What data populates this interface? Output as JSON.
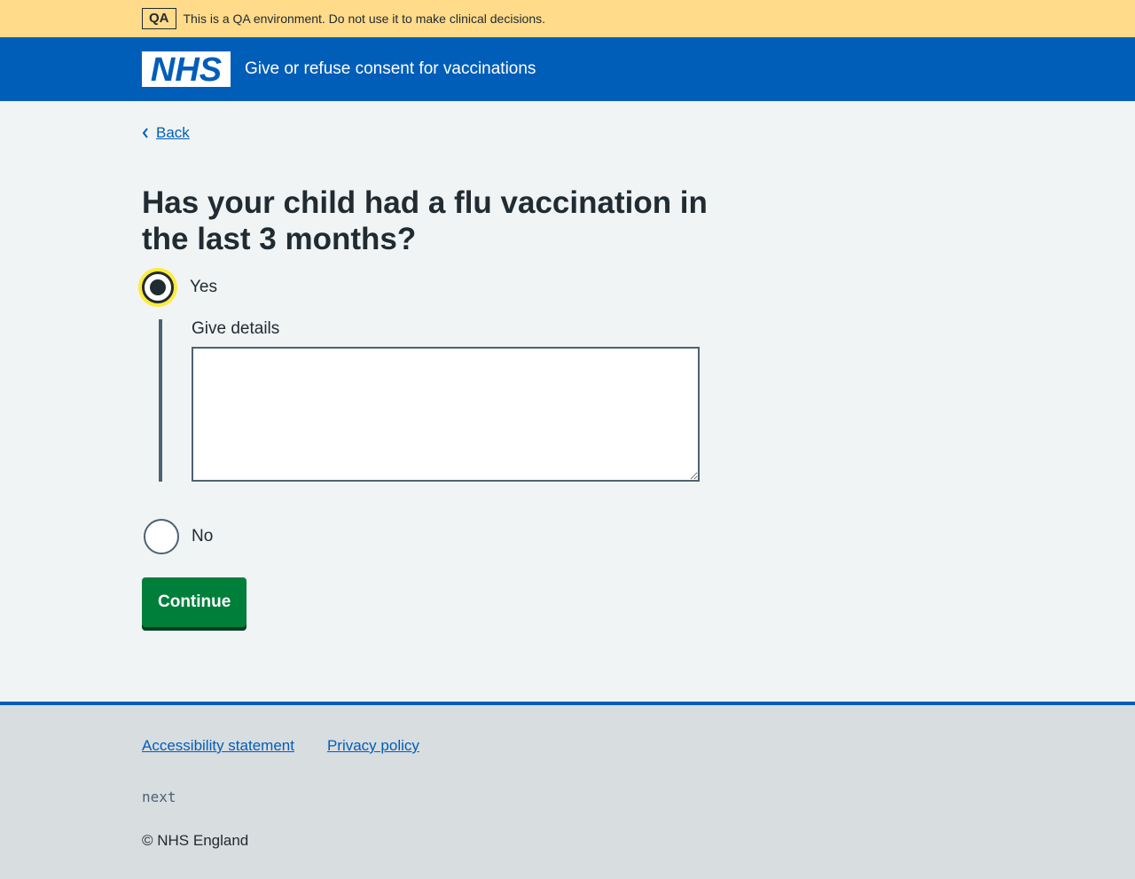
{
  "banner": {
    "tag": "QA",
    "message": "This is a QA environment. Do not use it to make clinical decisions."
  },
  "header": {
    "logo_text": "NHS",
    "title": "Give or refuse consent for vaccinations"
  },
  "main": {
    "back_label": "Back",
    "heading": "Has your child had a flu vaccination in the last 3 months?",
    "options": [
      {
        "label": "Yes",
        "selected": true
      },
      {
        "label": "No",
        "selected": false
      }
    ],
    "details_label": "Give details",
    "details_value": "",
    "continue_label": "Continue"
  },
  "footer": {
    "links": [
      "Accessibility statement",
      "Privacy policy"
    ],
    "mono_text": "next",
    "copyright": "© NHS England"
  },
  "colors": {
    "nhs_blue": "#005eb8",
    "qa_yellow": "#ffdb8a",
    "button_green": "#007f3b",
    "background": "#f0f4f5",
    "footer_bg": "#d8dde0"
  }
}
